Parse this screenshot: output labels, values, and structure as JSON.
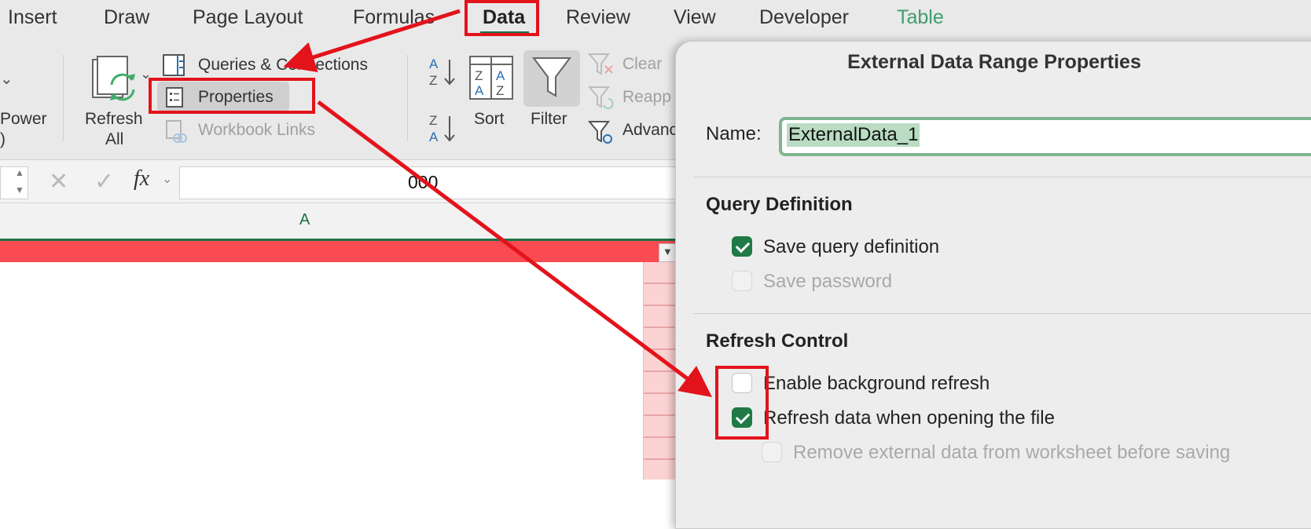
{
  "ribbon_tabs": [
    "Insert",
    "Draw",
    "Page Layout",
    "Formulas",
    "Data",
    "Review",
    "View",
    "Developer",
    "Table"
  ],
  "active_tab": "Data",
  "ribbon": {
    "power_label_line1": "Power",
    "power_label_line2": ")",
    "refresh_all_line1": "Refresh",
    "refresh_all_line2": "All",
    "queries_connections": "Queries & Connections",
    "properties": "Properties",
    "workbook_links": "Workbook Links",
    "sort": "Sort",
    "filter": "Filter",
    "clear": "Clear",
    "reapply": "Reapp",
    "advanced": "Advanc"
  },
  "formula_bar": {
    "fx": "fx",
    "value": "000"
  },
  "grid": {
    "column_a": "A"
  },
  "dialog": {
    "title": "External Data Range Properties",
    "name_label": "Name:",
    "name_value": "ExternalData_1",
    "query_definition_heading": "Query Definition",
    "save_query_definition": "Save query definition",
    "save_password": "Save password",
    "refresh_control_heading": "Refresh Control",
    "enable_background_refresh": "Enable background refresh",
    "refresh_on_open": "Refresh data when opening the file",
    "remove_external_data": "Remove external data from worksheet before saving"
  },
  "checkbox_states": {
    "save_query_definition": true,
    "save_password": false,
    "enable_background_refresh": false,
    "refresh_on_open": true,
    "remove_external_data": false
  },
  "colors": {
    "accent_green": "#1f7a46",
    "annotation_red": "#e3131b",
    "header_band_red": "#fa4a52",
    "table_tab_green": "#3f9e6b"
  }
}
